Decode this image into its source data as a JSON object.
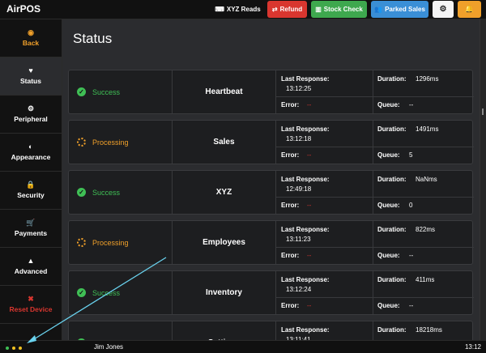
{
  "app": {
    "title": "AirPOS"
  },
  "toolbar": {
    "buttons": [
      {
        "label": "XYZ Reads",
        "icon": "keyboard-icon",
        "glyph": "⌨",
        "color": "#111111"
      },
      {
        "label": "Refund",
        "icon": "refund-icon",
        "glyph": "⇄",
        "color": "#d9362f"
      },
      {
        "label": "Stock Check",
        "icon": "barcode-icon",
        "glyph": "▥",
        "color": "#3ea84e"
      },
      {
        "label": "Parked Sales",
        "icon": "users-icon",
        "glyph": "👥",
        "color": "#3a8fd6"
      }
    ],
    "settings_icon": "gear-icon",
    "settings_glyph": "⚙",
    "notifications_icon": "bell-icon",
    "notifications_glyph": "🔔"
  },
  "sidebar": {
    "items": [
      {
        "label": "Back",
        "icon": "back-circle-icon",
        "glyph": "◉",
        "active": false
      },
      {
        "label": "Status",
        "icon": "heartbeat-icon",
        "glyph": "♥",
        "active": true
      },
      {
        "label": "Peripheral",
        "icon": "gear-icon",
        "glyph": "⚙",
        "active": false
      },
      {
        "label": "Appearance",
        "icon": "contrast-icon",
        "glyph": "◐",
        "active": false
      },
      {
        "label": "Security",
        "icon": "lock-icon",
        "glyph": "🔒",
        "active": false
      },
      {
        "label": "Payments",
        "icon": "cart-icon",
        "glyph": "🛒",
        "active": false
      },
      {
        "label": "Advanced",
        "icon": "warning-icon",
        "glyph": "▲",
        "active": false
      },
      {
        "label": "Reset Device",
        "icon": "close-icon",
        "glyph": "✖",
        "active": false
      }
    ]
  },
  "main": {
    "title": "Status",
    "labels": {
      "last_response": "Last Response:",
      "error": "Error:",
      "duration": "Duration:",
      "queue": "Queue:"
    },
    "services": [
      {
        "status": "Success",
        "state": "success",
        "name": "Heartbeat",
        "last_response": "13:12:25",
        "error": "--",
        "duration": "1296ms",
        "queue": "--"
      },
      {
        "status": "Processing",
        "state": "processing",
        "name": "Sales",
        "last_response": "13:12:18",
        "error": "--",
        "duration": "1491ms",
        "queue": "5"
      },
      {
        "status": "Success",
        "state": "success",
        "name": "XYZ",
        "last_response": "12:49:18",
        "error": "--",
        "duration": "NaNms",
        "queue": "0"
      },
      {
        "status": "Processing",
        "state": "processing",
        "name": "Employees",
        "last_response": "13:11:23",
        "error": "--",
        "duration": "822ms",
        "queue": "--"
      },
      {
        "status": "Success",
        "state": "success",
        "name": "Inventory",
        "last_response": "13:12:24",
        "error": "--",
        "duration": "411ms",
        "queue": "--"
      },
      {
        "status": "Success",
        "state": "success",
        "name": "Settings",
        "last_response": "13:11:41",
        "error": "--",
        "duration": "18218ms",
        "queue": "--"
      }
    ]
  },
  "statusbar": {
    "user": "Jim Jones",
    "time": "13:12",
    "dot_colors": [
      "#3fbf55",
      "#f0c020",
      "#f0c020"
    ]
  },
  "colors": {
    "success": "#3fbf55",
    "processing": "#f0a02a",
    "error": "#d9362f",
    "annotation_arrow": "#6ad3ef"
  }
}
